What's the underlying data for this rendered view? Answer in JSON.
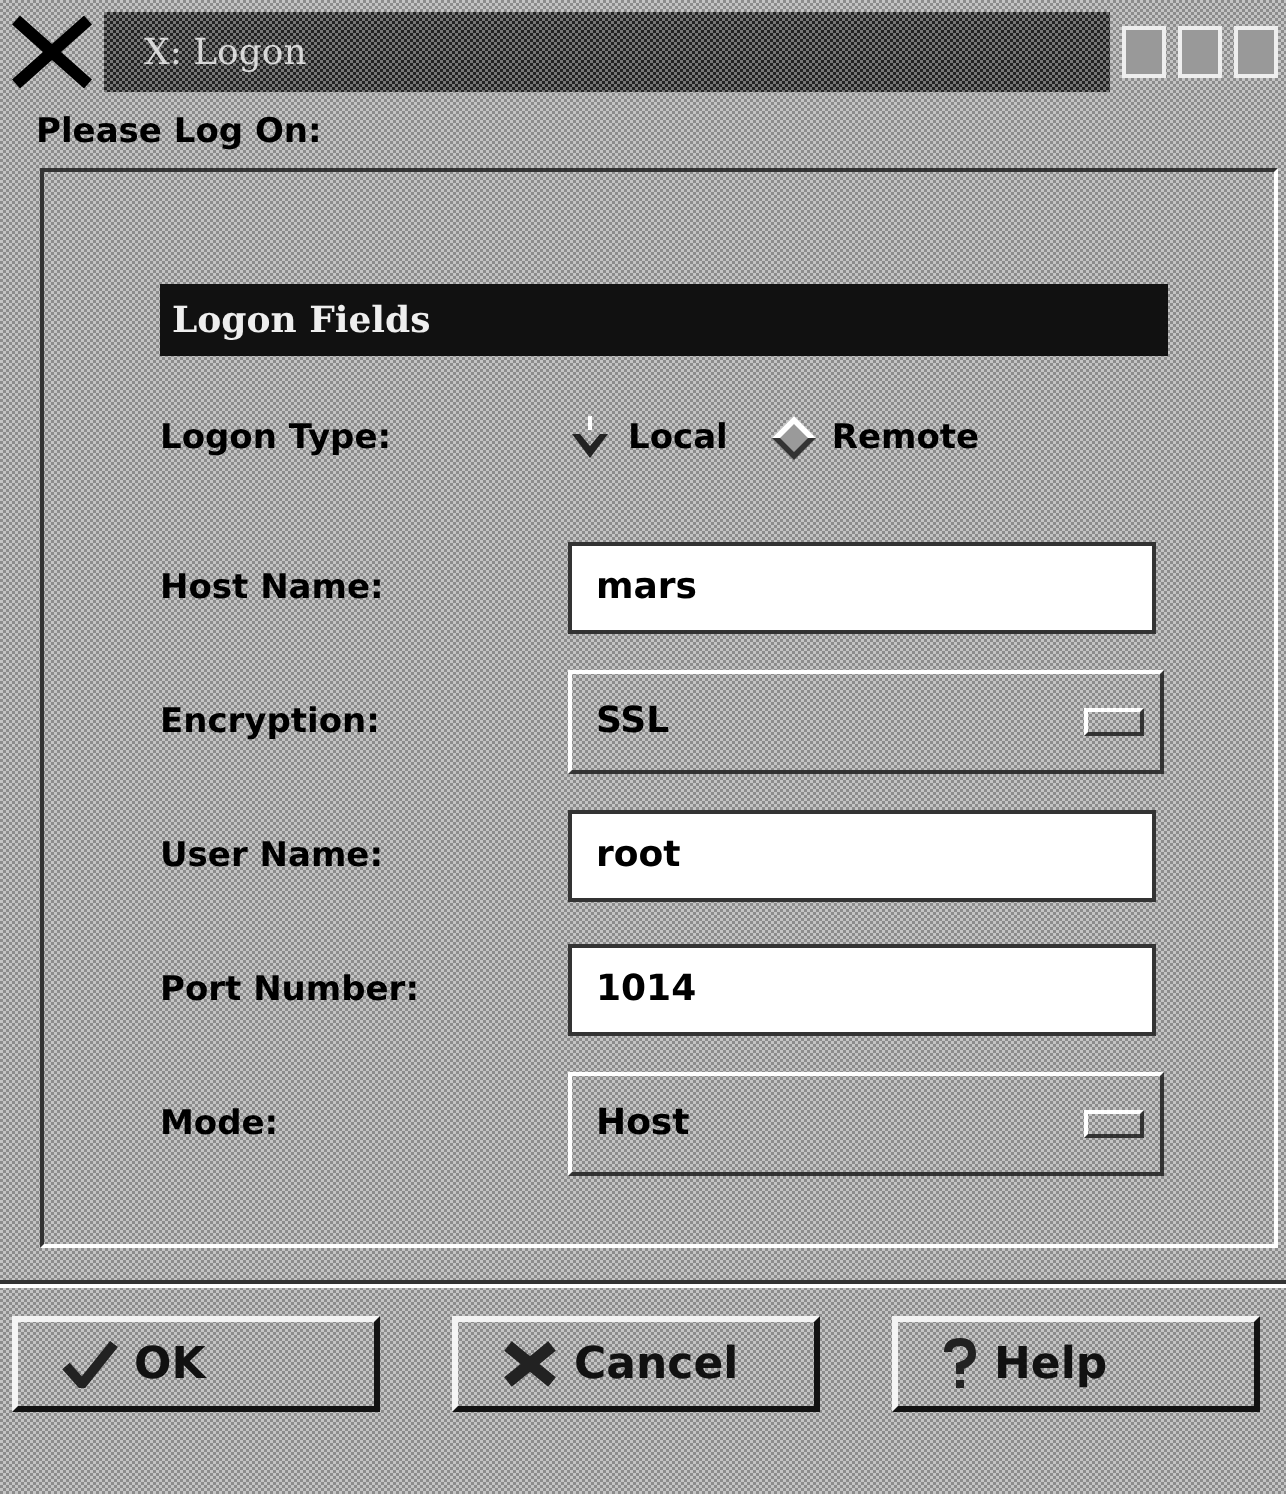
{
  "window": {
    "title": "X: Logon"
  },
  "prompt": "Please Log On:",
  "section": {
    "title": "Logon Fields"
  },
  "logon_type": {
    "label": "Logon Type:",
    "options": [
      {
        "label": "Local",
        "selected": true
      },
      {
        "label": "Remote",
        "selected": false
      }
    ]
  },
  "fields": [
    {
      "kind": "text",
      "label": "Host Name:",
      "value": "mars"
    },
    {
      "kind": "menu",
      "label": "Encryption:",
      "value": "SSL"
    },
    {
      "kind": "text",
      "label": "User Name:",
      "value": "root"
    },
    {
      "kind": "text",
      "label": "Port Number:",
      "value": "1014"
    },
    {
      "kind": "menu",
      "label": "Mode:",
      "value": "Host"
    }
  ],
  "buttons": [
    {
      "kind": "ok",
      "label": "OK"
    },
    {
      "kind": "cancel",
      "label": "Cancel"
    },
    {
      "kind": "help",
      "label": "Help"
    }
  ]
}
